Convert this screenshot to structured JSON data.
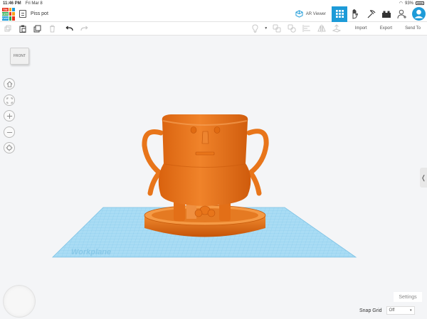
{
  "status": {
    "time": "11:46 PM",
    "date": "Fri Mar 8",
    "battery": "93%"
  },
  "app": {
    "logo_letters": [
      "TIN",
      "",
      "",
      "KER",
      "",
      "",
      "CAD",
      "",
      ""
    ],
    "doc_title": "Piss pot",
    "ar_label": "AR Viewer"
  },
  "toolbar": {
    "import_label": "Import",
    "export_label": "Export",
    "sendto_label": "Send To"
  },
  "viewport": {
    "viewcube_label": "FRONT",
    "workplane_label": "Workplane",
    "side_handle": "❬",
    "settings_label": "Settings",
    "snap_label": "Snap Grid",
    "snap_value": "Off",
    "snap_caret": "▾"
  },
  "colors": {
    "accent": "#1d9bd8",
    "model": "#e8751a",
    "grid": "#8fd0ef"
  },
  "icons": [
    "copy-icon",
    "paste-icon",
    "duplicate-icon",
    "delete-icon",
    "undo-icon",
    "redo-icon",
    "light-icon",
    "group-icon",
    "ungroup-icon",
    "align-icon",
    "mirror-icon",
    "workplane-icon"
  ]
}
